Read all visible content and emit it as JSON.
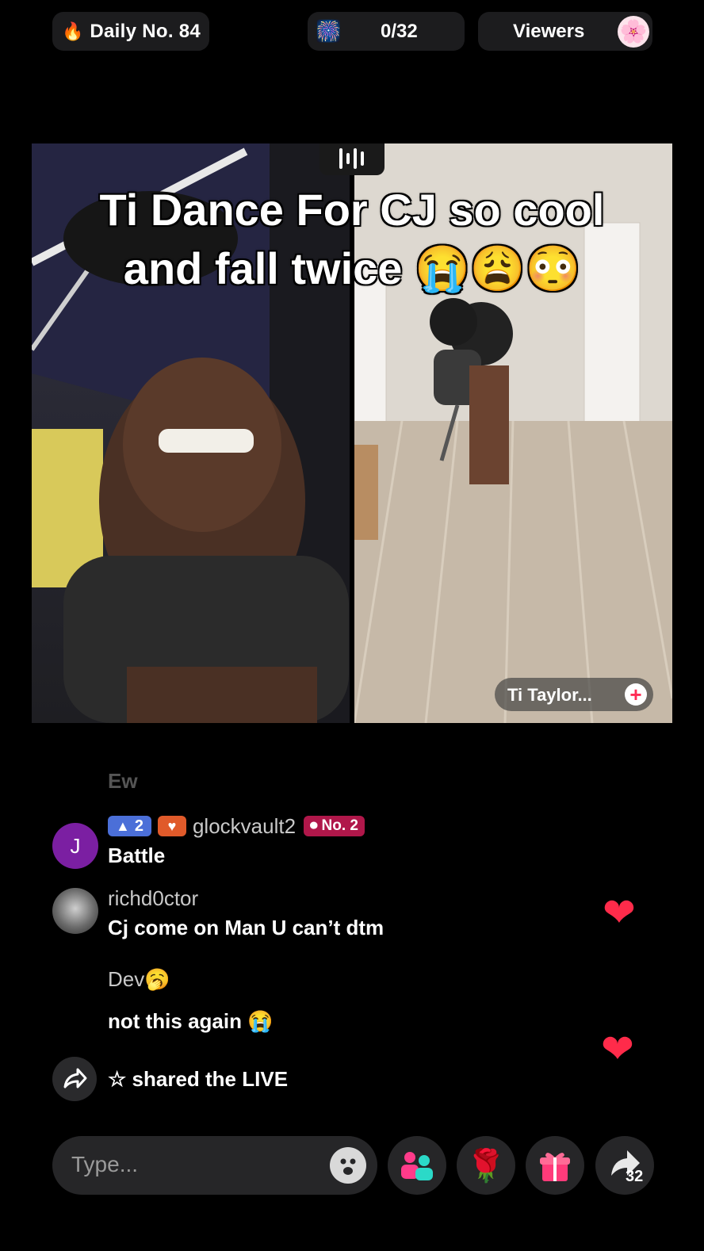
{
  "header": {
    "daily_label": "Daily No. 84",
    "progress_label": "0/32",
    "viewers_label": "Viewers"
  },
  "stream": {
    "caption_line1": "Ti Dance For CJ so cool",
    "caption_line2": "and fall twice 😭😩😳",
    "host_badge": "Ti  Taylor..."
  },
  "comments": {
    "faded_text": "Ew",
    "c1": {
      "avatar_letter": "J",
      "level": "2",
      "username": "glockvault2",
      "rank_badge": "No. 2",
      "text": "Battle"
    },
    "c2": {
      "username": "richd0ctor",
      "text": "Cj come on Man U can’t dtm"
    },
    "c3": {
      "username": "Dev🥱",
      "text": "not this again 😭"
    },
    "share": {
      "text": "☆ shared the LIVE"
    }
  },
  "composer": {
    "placeholder": "Type...",
    "share_count": "32"
  },
  "colors": {
    "accent": "#ff2b4a",
    "pill_bg": "#1c1c1e"
  }
}
